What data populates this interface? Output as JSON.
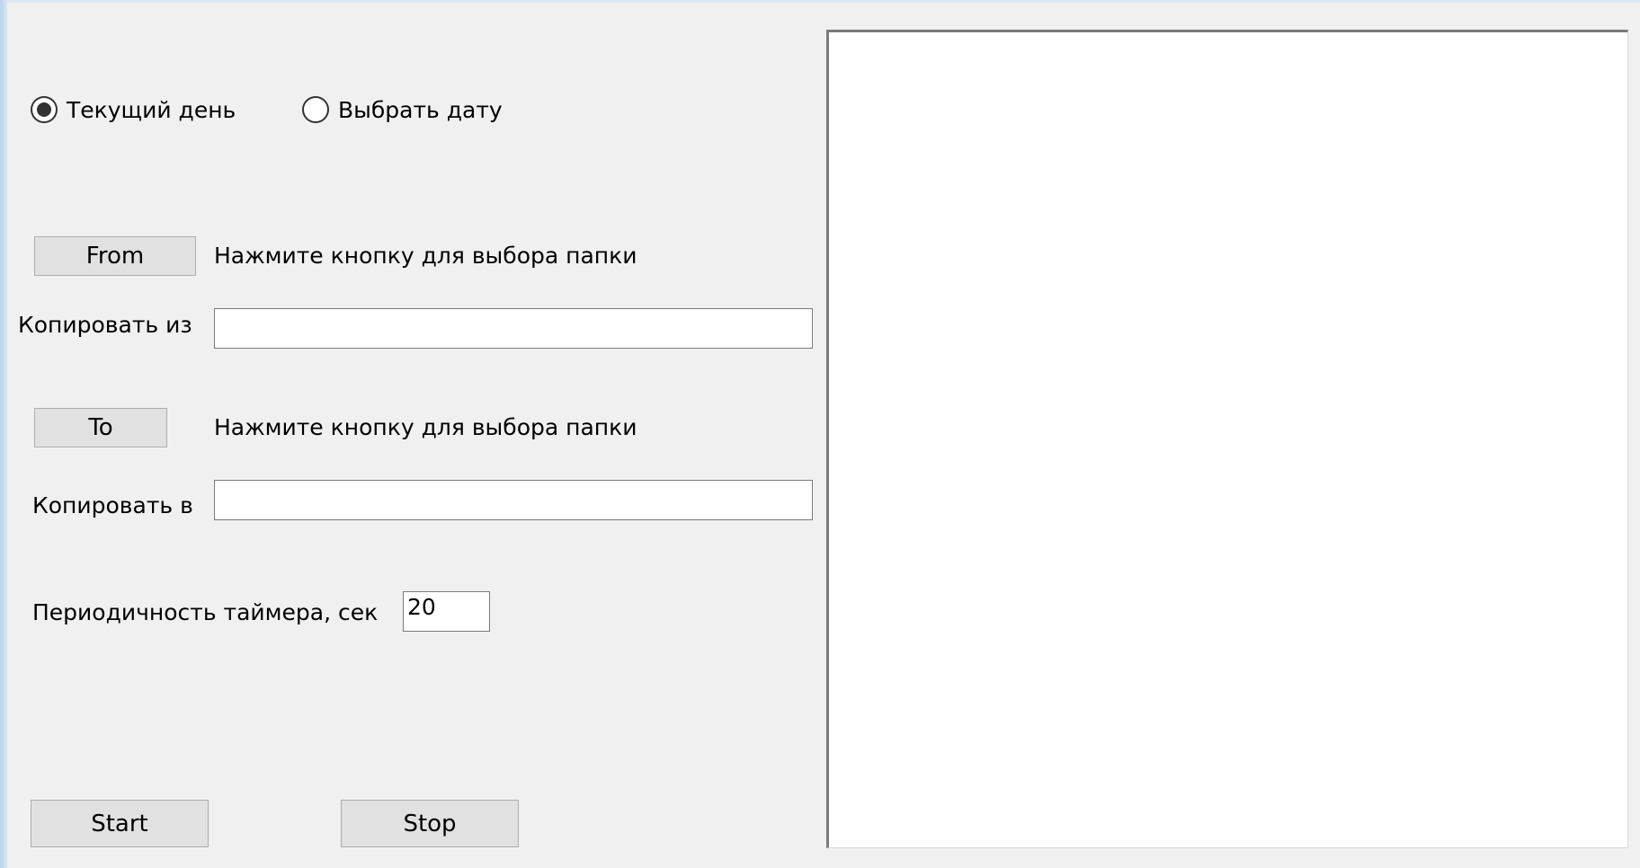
{
  "mode": {
    "options": [
      {
        "label": "Текущий день",
        "selected": true
      },
      {
        "label": "Выбрать дату",
        "selected": false
      }
    ]
  },
  "source": {
    "button_label": "From",
    "hint": "Нажмите кнопку для выбора папки",
    "field_label": "Копировать из",
    "field_value": ""
  },
  "destination": {
    "button_label": "To",
    "hint": "Нажмите кнопку для выбора папки",
    "field_label": "Копировать в",
    "field_value": ""
  },
  "timer": {
    "label": "Периодичность таймера, сек",
    "value": "20"
  },
  "actions": {
    "start_label": "Start",
    "stop_label": "Stop"
  },
  "log": {
    "text": ""
  }
}
